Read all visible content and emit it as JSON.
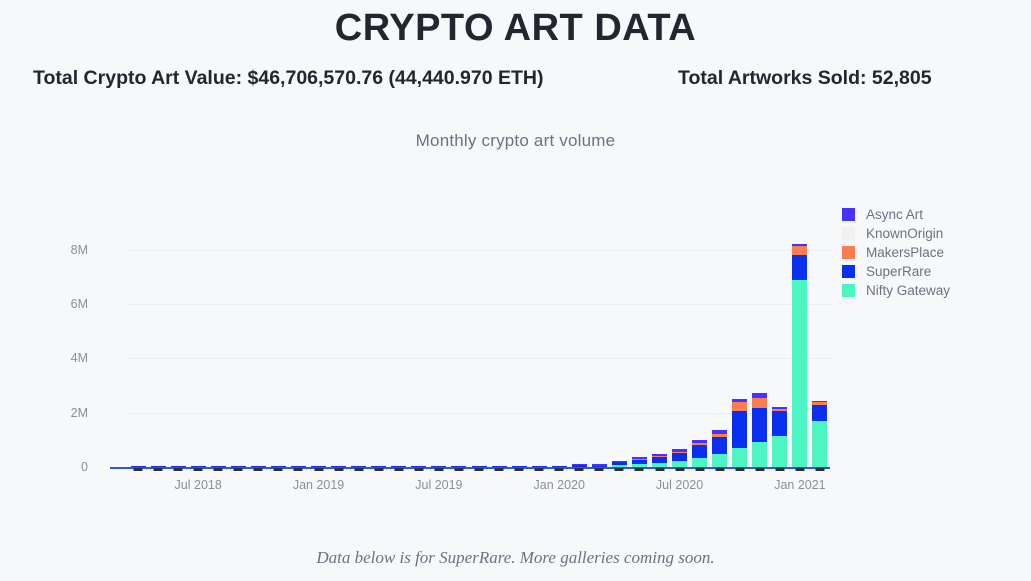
{
  "header": {
    "title": "CRYPTO ART DATA",
    "total_value_label": "Total Crypto Art Value: $46,706,570.76 (44,440.970 ETH)",
    "total_sold_label": "Total Artworks Sold: 52,805"
  },
  "footer": {
    "note": "Data below is for SuperRare. More galleries coming soon."
  },
  "colors": {
    "background": "#F7F8FA",
    "title": "#23262F",
    "muted_text": "#6B7280",
    "tick_text": "#8A9099",
    "gridline": "#ECEEF1",
    "axis": "#3355DD",
    "async_art": "#4733FF",
    "known_origin": "#F0F0F0",
    "makers_place": "#FB7D51",
    "super_rare": "#0A2FEF",
    "nifty_gateway": "#4DF5C2"
  },
  "chart_data": {
    "type": "bar",
    "stacked": true,
    "title": "Monthly crypto art volume",
    "xlabel": "",
    "ylabel": "",
    "ylim": [
      0,
      8800000
    ],
    "yticks": [
      0,
      2000000,
      4000000,
      6000000,
      8000000
    ],
    "ytick_labels": [
      "0",
      "2M",
      "4M",
      "6M",
      "8M"
    ],
    "grid": true,
    "legend_position": "right",
    "x_tick_labels": [
      "Jul 2018",
      "Jan 2019",
      "Jul 2019",
      "Jan 2020",
      "Jul 2020",
      "Jan 2021"
    ],
    "x_tick_indices": [
      3,
      9,
      15,
      21,
      27,
      33
    ],
    "categories": [
      "Apr 2018",
      "May 2018",
      "Jun 2018",
      "Jul 2018",
      "Aug 2018",
      "Sep 2018",
      "Oct 2018",
      "Nov 2018",
      "Dec 2018",
      "Jan 2019",
      "Feb 2019",
      "Mar 2019",
      "Apr 2019",
      "May 2019",
      "Jun 2019",
      "Jul 2019",
      "Aug 2019",
      "Sep 2019",
      "Oct 2019",
      "Nov 2019",
      "Dec 2019",
      "Jan 2020",
      "Feb 2020",
      "Mar 2020",
      "Apr 2020",
      "May 2020",
      "Jun 2020",
      "Jul 2020",
      "Aug 2020",
      "Sep 2020",
      "Oct 2020",
      "Nov 2020",
      "Dec 2020",
      "Jan 2021",
      "Feb 2021"
    ],
    "series": [
      {
        "name": "Nifty Gateway",
        "color": "#4DF5C2",
        "values": [
          0,
          0,
          0,
          0,
          0,
          0,
          0,
          0,
          0,
          0,
          0,
          0,
          0,
          0,
          0,
          0,
          0,
          0,
          0,
          0,
          0,
          0,
          0,
          0,
          60000,
          100000,
          130000,
          220000,
          330000,
          480000,
          700000,
          920000,
          1150000,
          6900000,
          1700000
        ]
      },
      {
        "name": "SuperRare",
        "color": "#0A2FEF",
        "values": [
          6000,
          9000,
          11000,
          12000,
          10000,
          9000,
          8000,
          9000,
          11000,
          12000,
          11000,
          13000,
          14000,
          13000,
          12000,
          14000,
          16000,
          17000,
          19000,
          22000,
          26000,
          40000,
          70000,
          55000,
          120000,
          150000,
          230000,
          300000,
          480000,
          640000,
          1350000,
          1250000,
          900000,
          900000,
          600000
        ]
      },
      {
        "name": "MakersPlace",
        "color": "#FB7D51",
        "values": [
          0,
          0,
          0,
          0,
          0,
          0,
          0,
          0,
          0,
          0,
          0,
          0,
          0,
          0,
          0,
          0,
          0,
          0,
          0,
          0,
          0,
          0,
          0,
          0,
          0,
          20000,
          30000,
          40000,
          70000,
          110000,
          330000,
          380000,
          100000,
          340000,
          80000
        ]
      },
      {
        "name": "KnownOrigin",
        "color": "#F0F0F0",
        "values": [
          0,
          0,
          0,
          0,
          0,
          0,
          0,
          0,
          0,
          0,
          0,
          0,
          0,
          0,
          0,
          0,
          0,
          0,
          0,
          0,
          0,
          0,
          0,
          0,
          0,
          0,
          0,
          0,
          0,
          0,
          0,
          0,
          0,
          0,
          0
        ]
      },
      {
        "name": "Async Art",
        "color": "#4733FF",
        "values": [
          0,
          0,
          0,
          0,
          0,
          0,
          0,
          0,
          0,
          0,
          0,
          0,
          0,
          0,
          0,
          0,
          0,
          0,
          0,
          0,
          0,
          0,
          30000,
          40000,
          60000,
          80000,
          90000,
          110000,
          130000,
          150000,
          130000,
          160000,
          60000,
          80000,
          60000
        ]
      }
    ]
  },
  "legend": {
    "items": [
      {
        "label": "Async Art",
        "color": "#4733FF"
      },
      {
        "label": "KnownOrigin",
        "color": "#F0F0F0"
      },
      {
        "label": "MakersPlace",
        "color": "#FB7D51"
      },
      {
        "label": "SuperRare",
        "color": "#0A2FEF"
      },
      {
        "label": "Nifty Gateway",
        "color": "#4DF5C2"
      }
    ]
  }
}
